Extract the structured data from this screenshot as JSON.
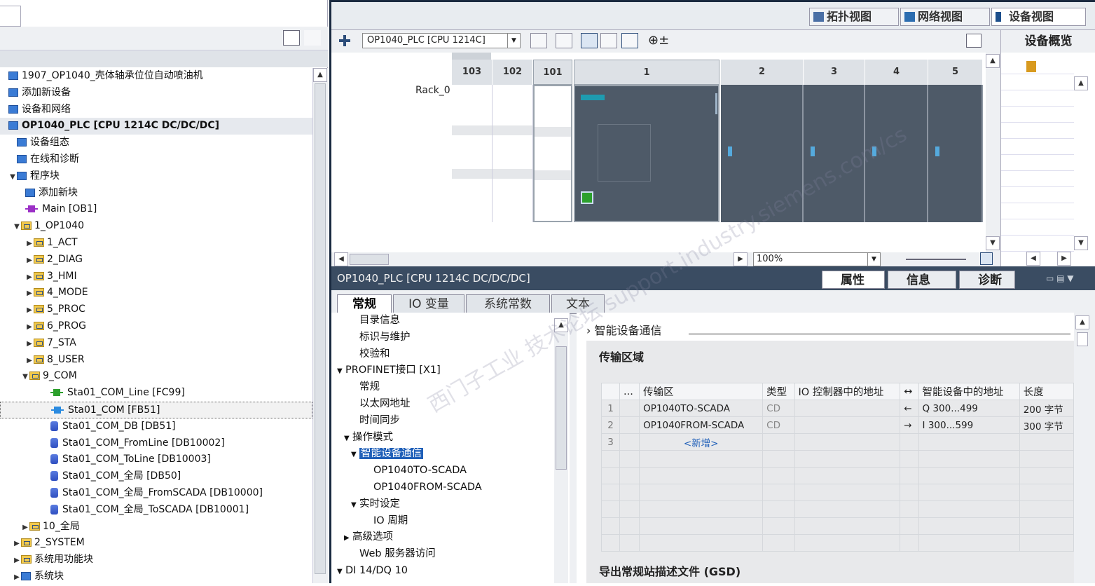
{
  "tree": {
    "items": [
      {
        "label": "1907_OP1040_壳体轴承位位自动喷油机",
        "indent": 0,
        "icon": "project-icon",
        "arrow": ""
      },
      {
        "label": "添加新设备",
        "indent": 0,
        "icon": "add-device-icon",
        "arrow": ""
      },
      {
        "label": "设备和网络",
        "indent": 0,
        "icon": "network-icon",
        "arrow": ""
      },
      {
        "label": "OP1040_PLC [CPU 1214C DC/DC/DC]",
        "indent": 0,
        "icon": "plc-icon",
        "arrow": ""
      },
      {
        "label": "设备组态",
        "indent": 1,
        "icon": "device-config-icon",
        "arrow": ""
      },
      {
        "label": "在线和诊断",
        "indent": 1,
        "icon": "diagnostics-icon",
        "arrow": ""
      },
      {
        "label": "程序块",
        "indent": 1,
        "icon": "program-blocks-icon",
        "arrow": "▼"
      },
      {
        "label": "添加新块",
        "indent": 2,
        "icon": "add-block-icon",
        "arrow": ""
      },
      {
        "label": "Main [OB1]",
        "indent": 2,
        "icon": "ob-icon",
        "arrow": ""
      },
      {
        "label": "1_OP1040",
        "indent": 1.5,
        "icon": "folder-icon",
        "arrow": "▼"
      },
      {
        "label": "1_ACT",
        "indent": 3,
        "icon": "folder-icon",
        "arrow": "▶"
      },
      {
        "label": "2_DIAG",
        "indent": 3,
        "icon": "folder-icon",
        "arrow": "▶"
      },
      {
        "label": "3_HMI",
        "indent": 3,
        "icon": "folder-icon",
        "arrow": "▶"
      },
      {
        "label": "4_MODE",
        "indent": 3,
        "icon": "folder-icon",
        "arrow": "▶"
      },
      {
        "label": "5_PROC",
        "indent": 3,
        "icon": "folder-icon",
        "arrow": "▶"
      },
      {
        "label": "6_PROG",
        "indent": 3,
        "icon": "folder-icon",
        "arrow": "▶"
      },
      {
        "label": "7_STA",
        "indent": 3,
        "icon": "folder-icon",
        "arrow": "▶"
      },
      {
        "label": "8_USER",
        "indent": 3,
        "icon": "folder-icon",
        "arrow": "▶"
      },
      {
        "label": "9_COM",
        "indent": 2.5,
        "icon": "folder-icon",
        "arrow": "▼"
      },
      {
        "label": "Sta01_COM_Line [FC99]",
        "indent": 5,
        "icon": "fc-icon",
        "arrow": ""
      },
      {
        "label": "Sta01_COM [FB51]",
        "indent": 5,
        "icon": "fb-icon",
        "arrow": ""
      },
      {
        "label": "Sta01_COM_DB [DB51]",
        "indent": 5,
        "icon": "db-icon",
        "arrow": ""
      },
      {
        "label": "Sta01_COM_FromLine [DB10002]",
        "indent": 5,
        "icon": "db-icon",
        "arrow": ""
      },
      {
        "label": "Sta01_COM_ToLine [DB10003]",
        "indent": 5,
        "icon": "db-icon",
        "arrow": ""
      },
      {
        "label": "Sta01_COM_全局 [DB50]",
        "indent": 5,
        "icon": "db-icon",
        "arrow": ""
      },
      {
        "label": "Sta01_COM_全局_FromSCADA [DB10000]",
        "indent": 5,
        "icon": "db-icon",
        "arrow": ""
      },
      {
        "label": "Sta01_COM_全局_ToSCADA [DB10001]",
        "indent": 5,
        "icon": "db-icon",
        "arrow": ""
      },
      {
        "label": "10_全局",
        "indent": 2.5,
        "icon": "folder-icon",
        "arrow": "▶"
      },
      {
        "label": "2_SYSTEM",
        "indent": 1.5,
        "icon": "folder-icon",
        "arrow": "▶"
      },
      {
        "label": "系统用功能块",
        "indent": 1.5,
        "icon": "folder-icon",
        "arrow": "▶"
      },
      {
        "label": "系统块",
        "indent": 1.5,
        "icon": "system-icon",
        "arrow": "▶"
      }
    ]
  },
  "device_view": {
    "tabs": [
      "拓扑视图",
      "网络视图",
      "设备视图"
    ],
    "device_select": "OP1040_PLC [CPU 1214C]",
    "rack_label": "Rack_0",
    "slots": [
      "103",
      "102",
      "101",
      "1",
      "2",
      "3",
      "4",
      "5"
    ],
    "zoom": "100%",
    "overview_title": "设备概览"
  },
  "properties": {
    "title": "OP1040_PLC [CPU 1214C DC/DC/DC]",
    "tabs": [
      "属性",
      "信息",
      "诊断"
    ],
    "subtabs": [
      "常规",
      "IO 变量",
      "系统常数",
      "文本"
    ],
    "nav": [
      {
        "label": "目录信息",
        "indent": 2,
        "arrow": ""
      },
      {
        "label": "标识与维护",
        "indent": 2,
        "arrow": ""
      },
      {
        "label": "校验和",
        "indent": 2,
        "arrow": ""
      },
      {
        "label": "PROFINET接口 [X1]",
        "indent": 0,
        "arrow": "▼"
      },
      {
        "label": "常规",
        "indent": 2,
        "arrow": ""
      },
      {
        "label": "以太网地址",
        "indent": 2,
        "arrow": ""
      },
      {
        "label": "时间同步",
        "indent": 2,
        "arrow": ""
      },
      {
        "label": "操作模式",
        "indent": 1,
        "arrow": "▼"
      },
      {
        "label": "智能设备通信",
        "indent": 2,
        "arrow": "▼"
      },
      {
        "label": "OP1040TO-SCADA",
        "indent": 4,
        "arrow": ""
      },
      {
        "label": "OP1040FROM-SCADA",
        "indent": 4,
        "arrow": ""
      },
      {
        "label": "实时设定",
        "indent": 2,
        "arrow": "▼"
      },
      {
        "label": "IO 周期",
        "indent": 4,
        "arrow": ""
      },
      {
        "label": "高级选项",
        "indent": 1,
        "arrow": "▶"
      },
      {
        "label": "Web 服务器访问",
        "indent": 2,
        "arrow": ""
      },
      {
        "label": "DI 14/DQ 10",
        "indent": 0,
        "arrow": "▼"
      }
    ],
    "section_header": "智能设备通信",
    "section_title": "传输区域",
    "table_headers": [
      "...",
      "传输区",
      "类型",
      "IO 控制器中的地址",
      "↔",
      "智能设备中的地址",
      "长度"
    ],
    "rows": [
      {
        "no": "1",
        "name": "OP1040TO-SCADA",
        "type": "CD",
        "ctrl_addr": "",
        "dir": "←",
        "dev_addr": "Q 300...499",
        "len": "200 字节"
      },
      {
        "no": "2",
        "name": "OP1040FROM-SCADA",
        "type": "CD",
        "ctrl_addr": "",
        "dir": "→",
        "dev_addr": "I 300...599",
        "len": "300 字节"
      },
      {
        "no": "3",
        "name": "<新增>",
        "type": "",
        "ctrl_addr": "",
        "dir": "",
        "dev_addr": "",
        "len": ""
      }
    ],
    "gsd_title": "导出常规站描述文件 (GSD)"
  },
  "watermark": "西门子工业 技术论坛 support.industry.siemens.com/cs"
}
